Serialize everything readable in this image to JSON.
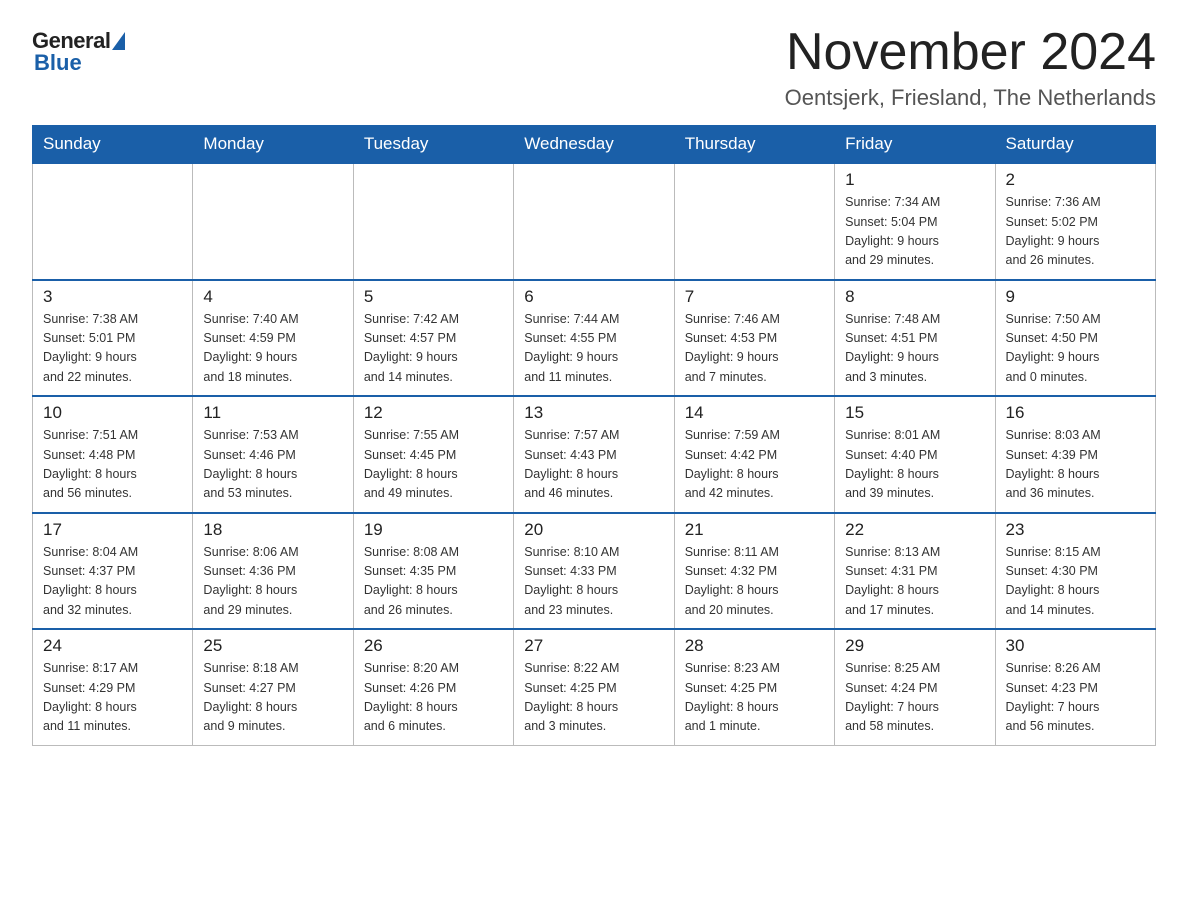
{
  "logo": {
    "general": "General",
    "blue": "Blue"
  },
  "header": {
    "month_year": "November 2024",
    "location": "Oentsjerk, Friesland, The Netherlands"
  },
  "days_of_week": [
    "Sunday",
    "Monday",
    "Tuesday",
    "Wednesday",
    "Thursday",
    "Friday",
    "Saturday"
  ],
  "weeks": [
    {
      "days": [
        {
          "number": "",
          "info": "",
          "empty": true
        },
        {
          "number": "",
          "info": "",
          "empty": true
        },
        {
          "number": "",
          "info": "",
          "empty": true
        },
        {
          "number": "",
          "info": "",
          "empty": true
        },
        {
          "number": "",
          "info": "",
          "empty": true
        },
        {
          "number": "1",
          "info": "Sunrise: 7:34 AM\nSunset: 5:04 PM\nDaylight: 9 hours\nand 29 minutes."
        },
        {
          "number": "2",
          "info": "Sunrise: 7:36 AM\nSunset: 5:02 PM\nDaylight: 9 hours\nand 26 minutes."
        }
      ]
    },
    {
      "days": [
        {
          "number": "3",
          "info": "Sunrise: 7:38 AM\nSunset: 5:01 PM\nDaylight: 9 hours\nand 22 minutes."
        },
        {
          "number": "4",
          "info": "Sunrise: 7:40 AM\nSunset: 4:59 PM\nDaylight: 9 hours\nand 18 minutes."
        },
        {
          "number": "5",
          "info": "Sunrise: 7:42 AM\nSunset: 4:57 PM\nDaylight: 9 hours\nand 14 minutes."
        },
        {
          "number": "6",
          "info": "Sunrise: 7:44 AM\nSunset: 4:55 PM\nDaylight: 9 hours\nand 11 minutes."
        },
        {
          "number": "7",
          "info": "Sunrise: 7:46 AM\nSunset: 4:53 PM\nDaylight: 9 hours\nand 7 minutes."
        },
        {
          "number": "8",
          "info": "Sunrise: 7:48 AM\nSunset: 4:51 PM\nDaylight: 9 hours\nand 3 minutes."
        },
        {
          "number": "9",
          "info": "Sunrise: 7:50 AM\nSunset: 4:50 PM\nDaylight: 9 hours\nand 0 minutes."
        }
      ]
    },
    {
      "days": [
        {
          "number": "10",
          "info": "Sunrise: 7:51 AM\nSunset: 4:48 PM\nDaylight: 8 hours\nand 56 minutes."
        },
        {
          "number": "11",
          "info": "Sunrise: 7:53 AM\nSunset: 4:46 PM\nDaylight: 8 hours\nand 53 minutes."
        },
        {
          "number": "12",
          "info": "Sunrise: 7:55 AM\nSunset: 4:45 PM\nDaylight: 8 hours\nand 49 minutes."
        },
        {
          "number": "13",
          "info": "Sunrise: 7:57 AM\nSunset: 4:43 PM\nDaylight: 8 hours\nand 46 minutes."
        },
        {
          "number": "14",
          "info": "Sunrise: 7:59 AM\nSunset: 4:42 PM\nDaylight: 8 hours\nand 42 minutes."
        },
        {
          "number": "15",
          "info": "Sunrise: 8:01 AM\nSunset: 4:40 PM\nDaylight: 8 hours\nand 39 minutes."
        },
        {
          "number": "16",
          "info": "Sunrise: 8:03 AM\nSunset: 4:39 PM\nDaylight: 8 hours\nand 36 minutes."
        }
      ]
    },
    {
      "days": [
        {
          "number": "17",
          "info": "Sunrise: 8:04 AM\nSunset: 4:37 PM\nDaylight: 8 hours\nand 32 minutes."
        },
        {
          "number": "18",
          "info": "Sunrise: 8:06 AM\nSunset: 4:36 PM\nDaylight: 8 hours\nand 29 minutes."
        },
        {
          "number": "19",
          "info": "Sunrise: 8:08 AM\nSunset: 4:35 PM\nDaylight: 8 hours\nand 26 minutes."
        },
        {
          "number": "20",
          "info": "Sunrise: 8:10 AM\nSunset: 4:33 PM\nDaylight: 8 hours\nand 23 minutes."
        },
        {
          "number": "21",
          "info": "Sunrise: 8:11 AM\nSunset: 4:32 PM\nDaylight: 8 hours\nand 20 minutes."
        },
        {
          "number": "22",
          "info": "Sunrise: 8:13 AM\nSunset: 4:31 PM\nDaylight: 8 hours\nand 17 minutes."
        },
        {
          "number": "23",
          "info": "Sunrise: 8:15 AM\nSunset: 4:30 PM\nDaylight: 8 hours\nand 14 minutes."
        }
      ]
    },
    {
      "days": [
        {
          "number": "24",
          "info": "Sunrise: 8:17 AM\nSunset: 4:29 PM\nDaylight: 8 hours\nand 11 minutes."
        },
        {
          "number": "25",
          "info": "Sunrise: 8:18 AM\nSunset: 4:27 PM\nDaylight: 8 hours\nand 9 minutes."
        },
        {
          "number": "26",
          "info": "Sunrise: 8:20 AM\nSunset: 4:26 PM\nDaylight: 8 hours\nand 6 minutes."
        },
        {
          "number": "27",
          "info": "Sunrise: 8:22 AM\nSunset: 4:25 PM\nDaylight: 8 hours\nand 3 minutes."
        },
        {
          "number": "28",
          "info": "Sunrise: 8:23 AM\nSunset: 4:25 PM\nDaylight: 8 hours\nand 1 minute."
        },
        {
          "number": "29",
          "info": "Sunrise: 8:25 AM\nSunset: 4:24 PM\nDaylight: 7 hours\nand 58 minutes."
        },
        {
          "number": "30",
          "info": "Sunrise: 8:26 AM\nSunset: 4:23 PM\nDaylight: 7 hours\nand 56 minutes."
        }
      ]
    }
  ]
}
